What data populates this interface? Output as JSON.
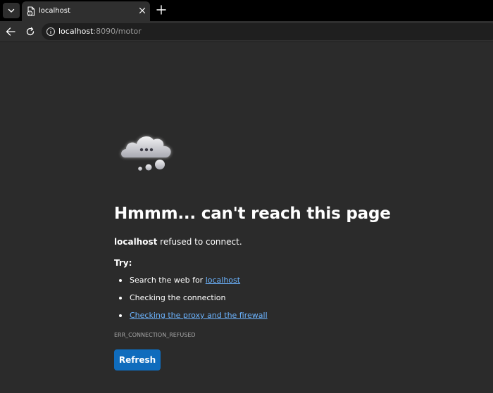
{
  "browser": {
    "tab": {
      "title": "localhost"
    },
    "address": {
      "host": "localhost",
      "rest": ":8090/motor"
    }
  },
  "error": {
    "title": "Hmmm... can't reach this page",
    "host": "localhost",
    "message": " refused to connect.",
    "try_label": "Try:",
    "suggestions": {
      "search_prefix": "Search the web for ",
      "search_link": "localhost",
      "connection": "Checking the connection",
      "proxy_link": "Checking the proxy and the firewall"
    },
    "code": "ERR_CONNECTION_REFUSED",
    "refresh_label": "Refresh"
  },
  "colors": {
    "page_bg": "#2b2b2b",
    "link": "#6cb4ff",
    "button": "#0f6cbd"
  },
  "icons": {
    "tab_menu": "chevron-down-icon",
    "favicon": "document-warning-icon",
    "close": "close-icon",
    "new_tab": "plus-icon",
    "back": "arrow-left-icon",
    "reload": "reload-icon",
    "info": "info-icon",
    "illustration": "thinking-cloud-icon"
  }
}
